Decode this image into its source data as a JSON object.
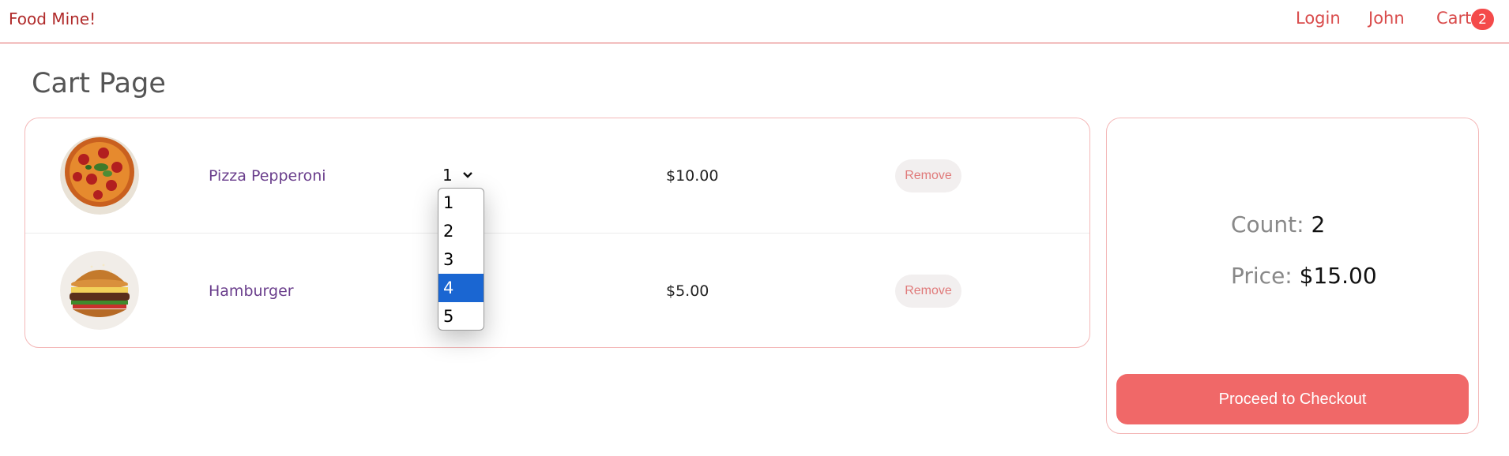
{
  "header": {
    "brand": "Food Mine!",
    "nav": {
      "login": "Login",
      "user": "John",
      "cart": "Cart"
    },
    "cart_count": "2"
  },
  "page": {
    "title": "Cart Page"
  },
  "cart_items": [
    {
      "name": "Pizza Pepperoni",
      "quantity": "1",
      "price": "$10.00",
      "remove_label": "Remove",
      "image_icon": "pizza-image"
    },
    {
      "name": "Hamburger",
      "quantity": "",
      "price": "$5.00",
      "remove_label": "Remove",
      "image_icon": "hamburger-image"
    }
  ],
  "quantity_dropdown": {
    "options": [
      "1",
      "2",
      "3",
      "4",
      "5"
    ],
    "highlighted": "4"
  },
  "summary": {
    "count_label": "Count:",
    "count_value": "2",
    "price_label": "Price:",
    "price_value": "$15.00",
    "checkout_label": "Proceed to Checkout"
  },
  "colors": {
    "accent": "#f06868",
    "brand": "#b02a2a",
    "highlight": "#1a66d2"
  }
}
